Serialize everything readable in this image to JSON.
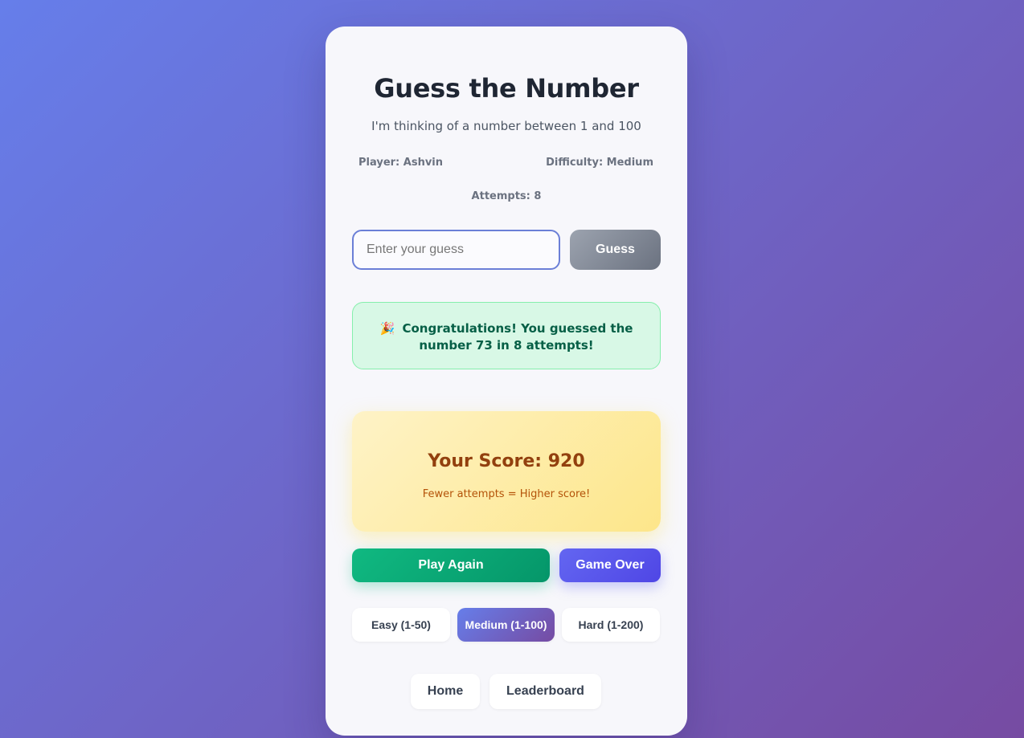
{
  "game": {
    "title": "Guess the Number",
    "subtitle": "I'm thinking of a number between 1 and 100",
    "player_label": "Player: Ashvin",
    "difficulty_label": "Difficulty: Medium",
    "attempts_label": "Attempts: 8"
  },
  "guess_form": {
    "placeholder": "Enter your guess",
    "value": "",
    "button_label": "Guess"
  },
  "result": {
    "icon": "party-popper-icon",
    "icon_glyph": "🎉",
    "message": "Congratulations! You guessed the number 73 in 8 attempts!"
  },
  "score": {
    "title": "Your Score: 920",
    "note": "Fewer attempts = Higher score!"
  },
  "actions": {
    "play_again_label": "Play Again",
    "game_over_label": "Game Over"
  },
  "difficulty_options": [
    {
      "label": "Easy (1-50)",
      "selected": false
    },
    {
      "label": "Medium (1-100)",
      "selected": true
    },
    {
      "label": "Hard (1-200)",
      "selected": false
    }
  ],
  "nav": {
    "home_label": "Home",
    "leaderboard_label": "Leaderboard"
  },
  "colors": {
    "background_start": "#667eea",
    "background_end": "#764ba2",
    "success_bg": "#d8f8e6",
    "success_text": "#065f46",
    "score_text": "#92400e",
    "play_again": "#10b981",
    "game_over": "#6366f1"
  }
}
